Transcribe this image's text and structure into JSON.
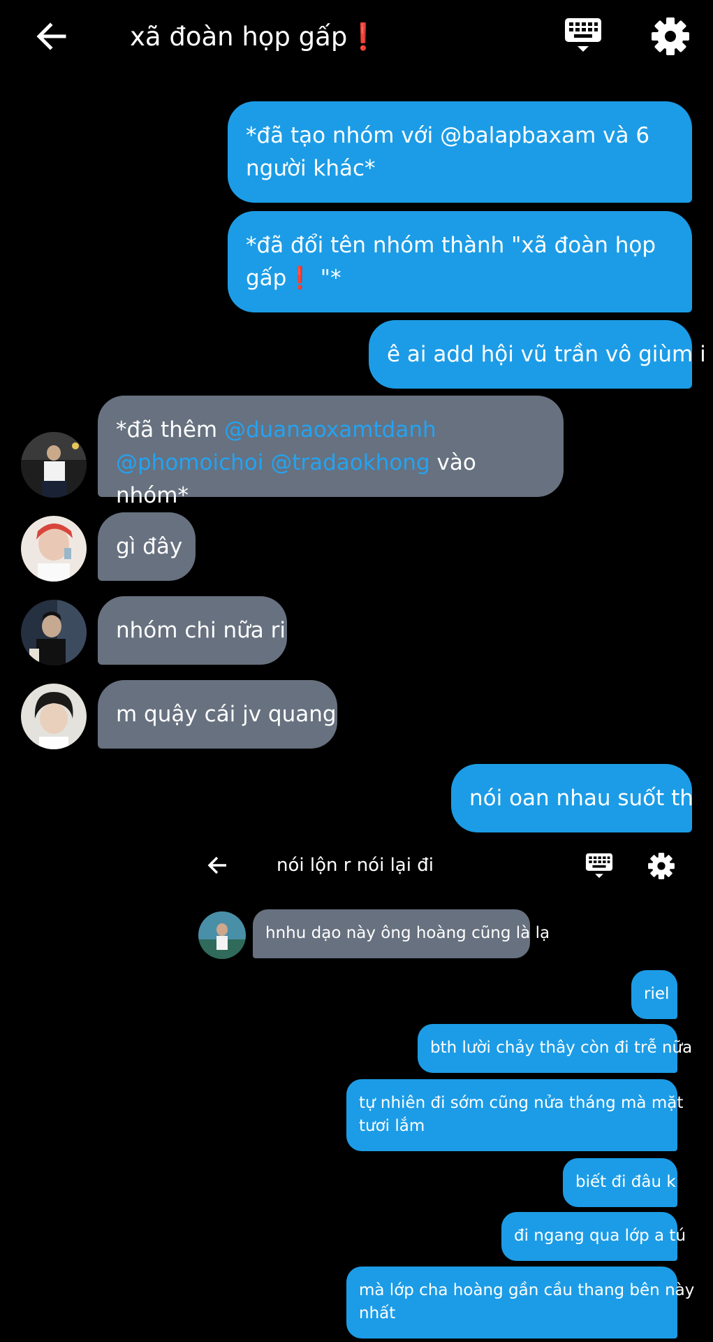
{
  "header": {
    "title": "xã đoàn họp gấp❗",
    "back_icon": "arrow-left-icon",
    "keyboard_icon": "keyboard-icon",
    "settings_icon": "gear-icon"
  },
  "messages": [
    {
      "side": "sent",
      "text": "*đã tạo nhóm với @balapbaxam và 6 người khác*"
    },
    {
      "side": "sent",
      "text": "*đã đổi tên nhóm thành \"xã đoàn họp gấp❗ \"*"
    },
    {
      "side": "sent",
      "text": "ê ai add hội vũ trần vô giùm i"
    },
    {
      "side": "received",
      "prefix": "*đã thêm ",
      "mentions": [
        "@duanaoxamtdanh",
        "@phomoichoi",
        "@tradaokhong"
      ],
      "suffix": " vào nhóm*"
    },
    {
      "side": "received",
      "text": "gì đây"
    },
    {
      "side": "received",
      "text": "nhóm chi nữa ri"
    },
    {
      "side": "received",
      "text": "m quậy cái jv quang"
    },
    {
      "side": "sent",
      "text": "nói oan nhau suốt th"
    }
  ],
  "sub_chat": {
    "title": "nói lộn r nói lại đi",
    "messages": [
      {
        "side": "received",
        "text": "hnhu dạo này ông hoàng cũng là lạ"
      },
      {
        "side": "sent",
        "text": "riel"
      },
      {
        "side": "sent",
        "text": "bth lười chảy thây còn đi trễ nữa"
      },
      {
        "side": "sent",
        "line1": "tự nhiên đi sớm cũng nửa tháng mà mặt",
        "line2": "tươi lắm"
      },
      {
        "side": "sent",
        "text": "biết đi đâu k"
      },
      {
        "side": "sent",
        "text": "đi ngang qua lớp a tú"
      },
      {
        "side": "sent",
        "line1": "mà lớp cha hoàng gần cầu thang bên này",
        "line2": "nhất"
      }
    ]
  },
  "colors": {
    "background": "#000000",
    "sent_bubble": "#1c9ce6",
    "received_bubble": "#67717f",
    "mention": "#24a3f2"
  }
}
